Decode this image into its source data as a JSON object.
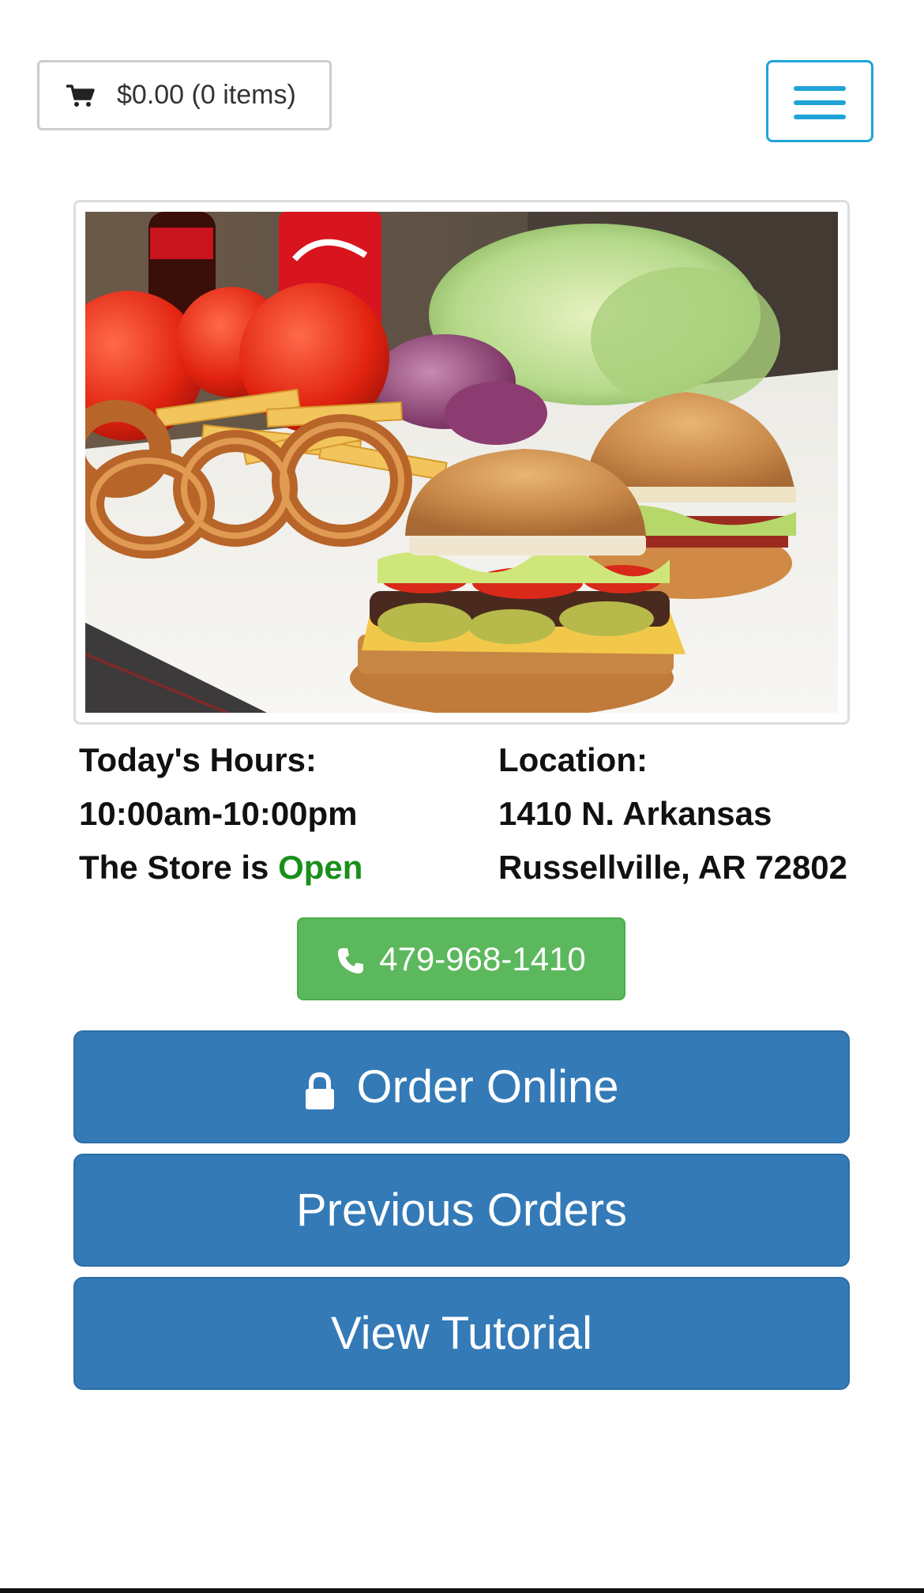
{
  "header": {
    "cart_label": "$0.00 (0 items)",
    "cart_icon": "shopping-cart-icon",
    "menu_icon": "hamburger-menu-icon",
    "accent_color": "#1fa3d8"
  },
  "hero": {
    "image_description_icon": "burgers-fries-photo"
  },
  "hours": {
    "heading": "Today's Hours:",
    "value": "10:00am-10:00pm",
    "status_prefix": "The Store is",
    "status_value": "Open",
    "status_color": "#1a8f1a"
  },
  "location": {
    "heading": "Location:",
    "street": "1410 N. Arkansas",
    "city": "Russellville, AR 72802"
  },
  "phone": {
    "label": "479-968-1410",
    "icon": "phone-icon",
    "color": "#5cb85c"
  },
  "actions": {
    "order_online": "Order Online",
    "order_icon": "lock-icon",
    "previous_orders": "Previous Orders",
    "view_tutorial": "View Tutorial",
    "color": "#337ab7"
  }
}
